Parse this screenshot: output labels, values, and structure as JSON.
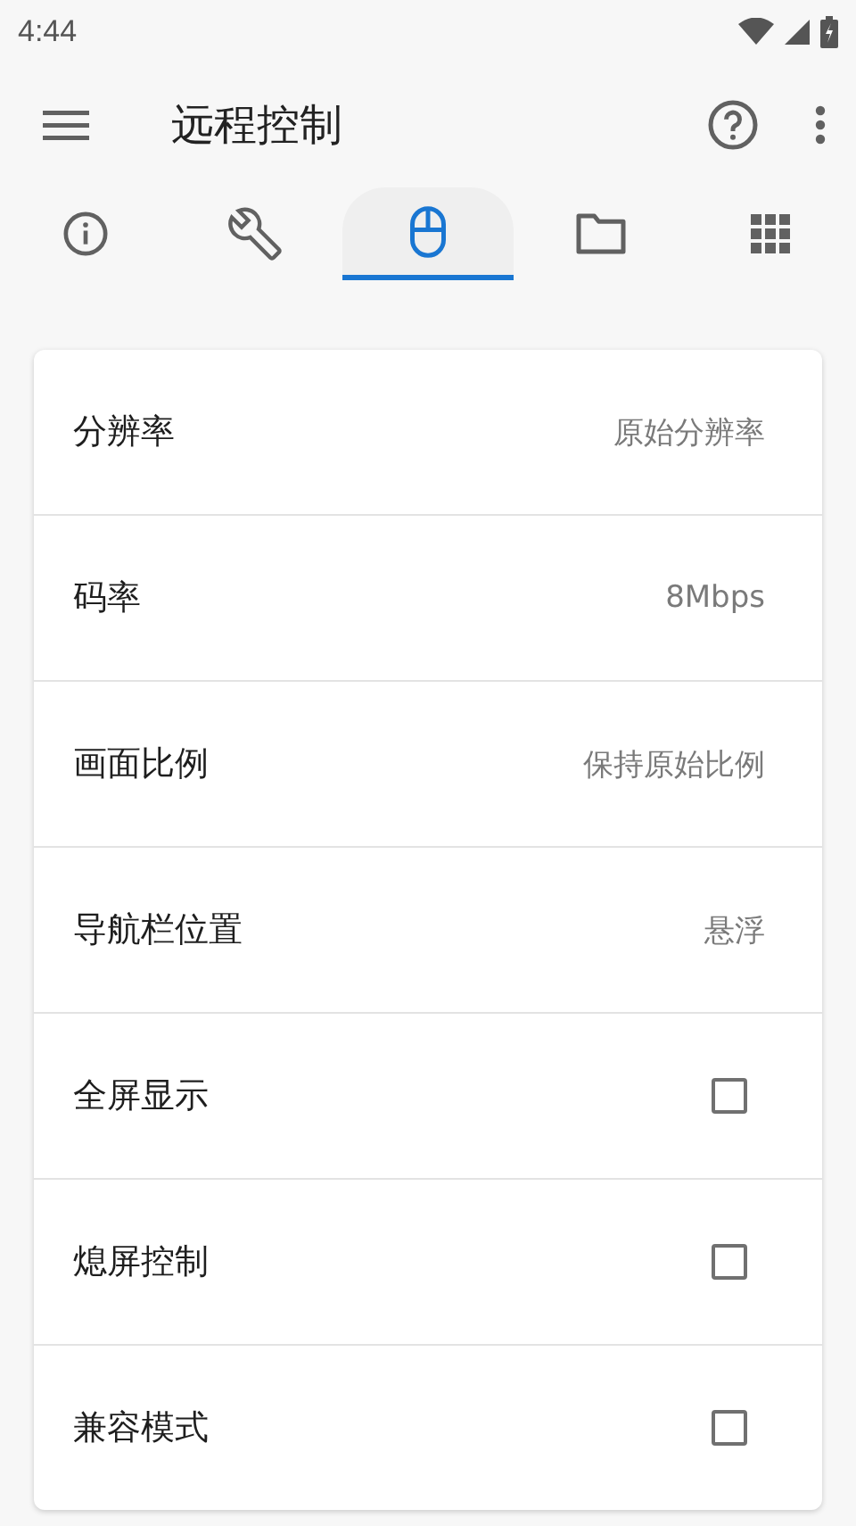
{
  "status_bar": {
    "time": "4:44"
  },
  "app_bar": {
    "title": "远程控制"
  },
  "tabs": [
    {
      "kind": "info",
      "selected": false
    },
    {
      "kind": "wrench",
      "selected": false
    },
    {
      "kind": "mouse",
      "selected": true
    },
    {
      "kind": "folder",
      "selected": false
    },
    {
      "kind": "apps",
      "selected": false
    }
  ],
  "settings": [
    {
      "kind": "value",
      "label": "分辨率",
      "value": "原始分辨率"
    },
    {
      "kind": "value",
      "label": "码率",
      "value": "8Mbps"
    },
    {
      "kind": "value",
      "label": "画面比例",
      "value": "保持原始比例"
    },
    {
      "kind": "value",
      "label": "导航栏位置",
      "value": "悬浮"
    },
    {
      "kind": "checkbox",
      "label": "全屏显示",
      "checked": false
    },
    {
      "kind": "checkbox",
      "label": "熄屏控制",
      "checked": false
    },
    {
      "kind": "checkbox",
      "label": "兼容模式",
      "checked": false
    }
  ]
}
